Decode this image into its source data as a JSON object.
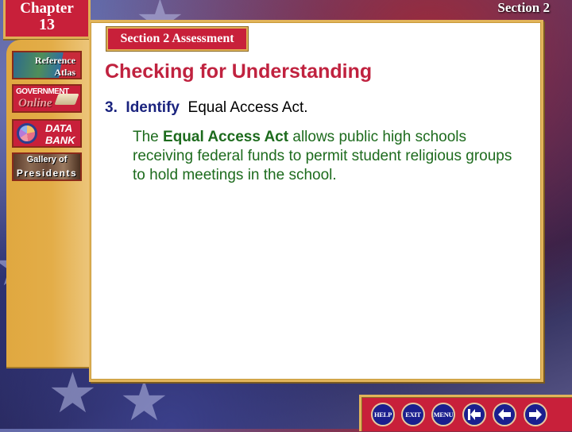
{
  "header": {
    "chapter_label": "Chapter",
    "chapter_number": "13",
    "section_label": "Section 2",
    "assessment_tab": "Section 2 Assessment"
  },
  "sidebar": {
    "items": [
      {
        "id": "reference-atlas",
        "line1": "Reference",
        "line2": "Atlas"
      },
      {
        "id": "government-online",
        "line1": "GOVERNMENT",
        "line2": "Online"
      },
      {
        "id": "data-bank",
        "line1": "DATA",
        "line2": "BANK"
      },
      {
        "id": "gallery-of-presidents",
        "line1": "Gallery of",
        "line2": "Presidents"
      }
    ]
  },
  "main": {
    "title": "Checking for Understanding",
    "question": {
      "number": "3.",
      "verb": "Identify",
      "term": "Equal Access Act."
    },
    "answer": {
      "prefix": "The ",
      "bold_term": "Equal Access Act",
      "text": " allows public high schools receiving federal funds to permit student religious groups to hold meetings in the school."
    }
  },
  "nav": {
    "help_label": "HELP",
    "exit_label": "EXIT",
    "menu_label": "MENU",
    "icons": [
      "first-slide-icon",
      "previous-arrow-icon",
      "next-arrow-icon"
    ]
  },
  "colors": {
    "title_red": "#c0223f",
    "question_blue": "#1a237e",
    "answer_green": "#1d6b1d",
    "tab_red": "#c8203a",
    "gold": "#e2b45a",
    "nav_blue": "#1a1f8e"
  }
}
